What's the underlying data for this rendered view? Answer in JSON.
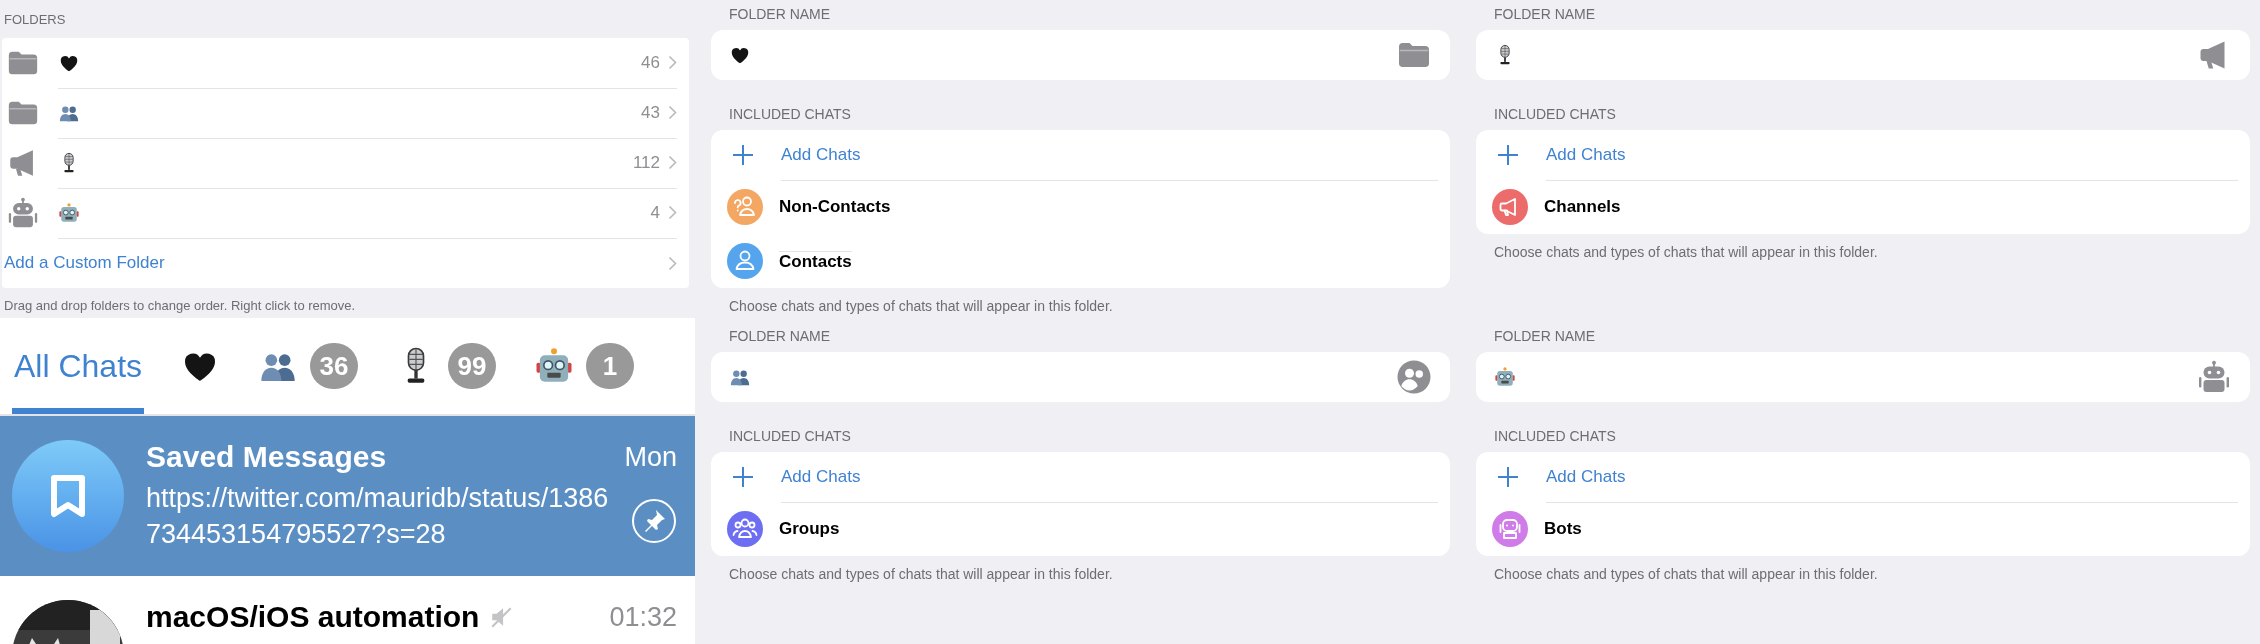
{
  "folders_section": {
    "label": "FOLDERS",
    "folders": [
      {
        "kind": "heart",
        "folder_icon": {
          "kind": "folder"
        },
        "count": "46"
      },
      {
        "kind": "people",
        "folder_icon": {
          "kind": "folder"
        },
        "count": "43"
      },
      {
        "kind": "microphone",
        "folder_icon": {
          "kind": "channels"
        },
        "count": "112"
      },
      {
        "kind": "robot",
        "folder_icon": {
          "kind": "bots"
        },
        "count": "4"
      }
    ],
    "add_label": "Add a Custom Folder",
    "footer": "Drag and drop folders to change order. Right click to remove."
  },
  "chat_list": {
    "tabs": [
      {
        "label": "All Chats",
        "selected": true
      },
      {
        "kind": "heart",
        "selected": false
      },
      {
        "kind": "people",
        "badge": "36",
        "selected": false
      },
      {
        "kind": "microphone",
        "badge": "99",
        "selected": false
      },
      {
        "kind": "robot",
        "badge": "1",
        "selected": false
      }
    ],
    "chats": [
      {
        "kind": "saved",
        "title": "Saved Messages",
        "time": "Mon",
        "message": "https://twitter.com/mauridb/status/1386734453154795527?s=28",
        "pinned": true,
        "muted": false,
        "selected": true
      },
      {
        "kind": "picture",
        "title": "macOS/iOS automation",
        "time": "01:32",
        "pinned": false,
        "muted": true,
        "selected": false
      }
    ]
  },
  "editors": [
    {
      "name_label": "FOLDER NAME",
      "kind": "heart",
      "folder_icon": {
        "kind": "folder"
      },
      "included_label": "INCLUDED CHATS",
      "add_label": "Add Chats",
      "chat_types": [
        {
          "kind": "non_contacts",
          "label": "Non-Contacts"
        },
        {
          "kind": "contacts",
          "label": "Contacts"
        }
      ],
      "footer": "Choose chats and types of chats that will appear in this folder."
    },
    {
      "name_label": "FOLDER NAME",
      "kind": "people",
      "folder_icon": {
        "kind": "groups"
      },
      "included_label": "INCLUDED CHATS",
      "add_label": "Add Chats",
      "chat_types": [
        {
          "kind": "groups",
          "label": "Groups"
        }
      ],
      "footer": "Choose chats and types of chats that will appear in this folder."
    },
    {
      "name_label": "FOLDER NAME",
      "kind": "microphone",
      "folder_icon": {
        "kind": "channels"
      },
      "included_label": "INCLUDED CHATS",
      "add_label": "Add Chats",
      "chat_types": [
        {
          "kind": "channels",
          "label": "Channels"
        }
      ],
      "footer": "Choose chats and types of chats that will appear in this folder."
    },
    {
      "name_label": "FOLDER NAME",
      "kind": "robot",
      "folder_icon": {
        "kind": "bots"
      },
      "included_label": "INCLUDED CHATS",
      "add_label": "Add Chats",
      "chat_types": [
        {
          "kind": "bots",
          "label": "Bots"
        }
      ],
      "footer": "Choose chats and types of chats that will appear in this folder."
    }
  ]
}
